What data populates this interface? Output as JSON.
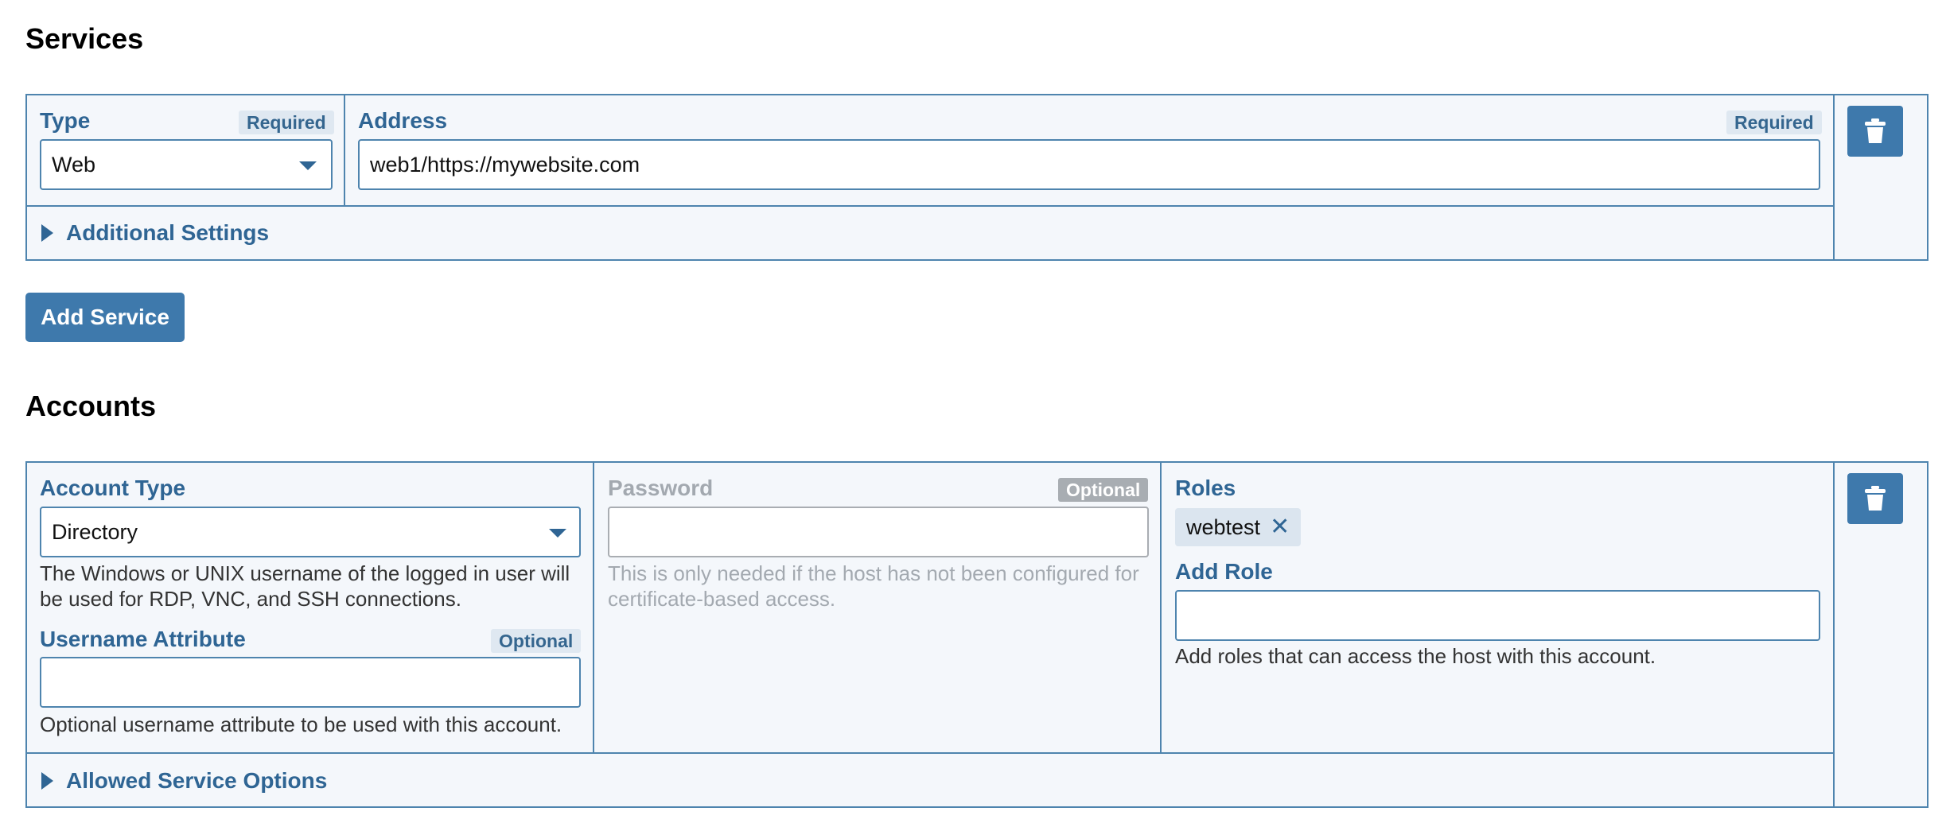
{
  "services": {
    "title": "Services",
    "type": {
      "label": "Type",
      "badge": "Required",
      "value": "Web"
    },
    "address": {
      "label": "Address",
      "badge": "Required",
      "value": "web1/https://mywebsite.com"
    },
    "additional_settings": "Additional Settings",
    "add_button": "Add Service"
  },
  "accounts": {
    "title": "Accounts",
    "account_type": {
      "label": "Account Type",
      "value": "Directory",
      "help": "The Windows or UNIX username of the logged in user will be used for RDP, VNC, and SSH connections."
    },
    "username_attribute": {
      "label": "Username Attribute",
      "badge": "Optional",
      "value": "",
      "help": "Optional username attribute to be used with this account."
    },
    "password": {
      "label": "Password",
      "badge": "Optional",
      "value": "",
      "help": "This is only needed if the host has not been configured for certificate-based access."
    },
    "roles": {
      "label": "Roles",
      "chips": [
        "webtest"
      ],
      "add_role_label": "Add Role",
      "add_role_value": "",
      "help": "Add roles that can access the host with this account."
    },
    "allowed_service_options": "Allowed Service Options"
  },
  "icons": {
    "delete": "trash-icon",
    "remove": "close-icon",
    "expand": "triangle-right-icon",
    "dropdown": "caret-down-icon"
  },
  "colors": {
    "accent": "#3e79ac",
    "border": "#4e84ae",
    "label": "#2f6594",
    "panel": "#f4f7fb"
  }
}
